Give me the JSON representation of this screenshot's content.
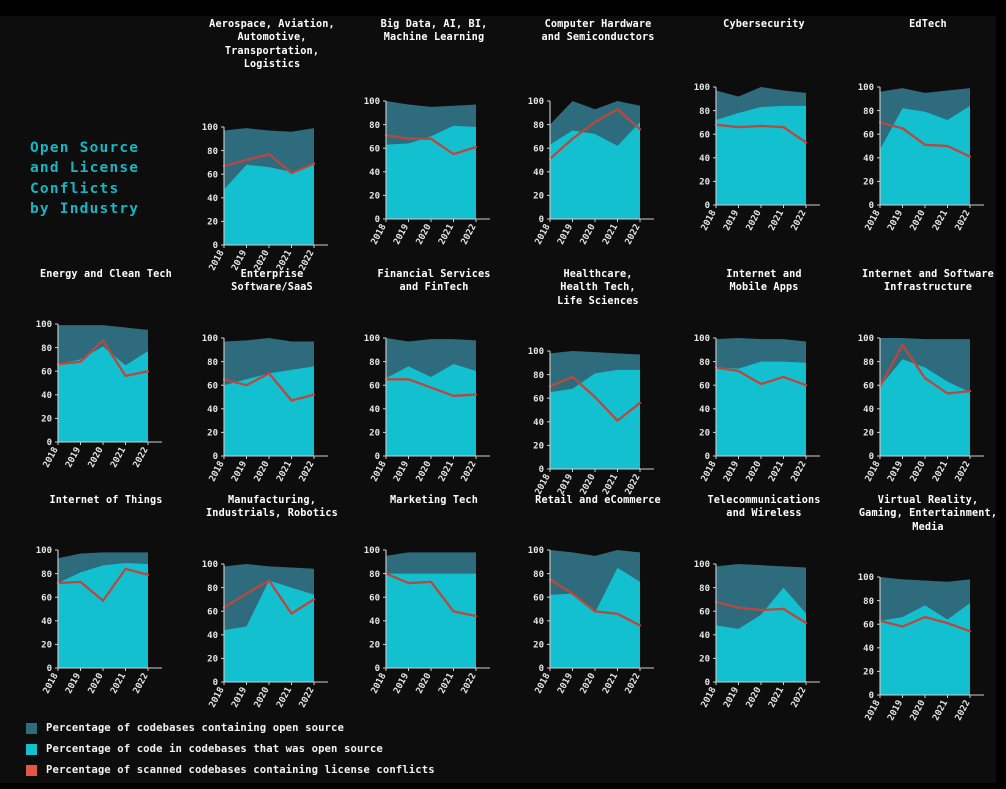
{
  "title": "Open Source\nand License\nConflicts\nby Industry",
  "colors": {
    "background": "#0d0d0d",
    "outer": "#000000",
    "title_text": "#17b6c4",
    "panel_title_text": "#ffffff",
    "codebases_containing_open_source": "#2e6b7d",
    "code_that_was_open_source": "#13c0cf",
    "license_conflicts": "#b9483f",
    "axis": "#cfcfcf",
    "tick_text": "#e6e6e6"
  },
  "legend": {
    "items": [
      {
        "label": "Percentage of codebases containing open source",
        "color": "#2e6b7d",
        "swatch": "square-swatch"
      },
      {
        "label": "Percentage of code in codebases that was open source",
        "color": "#13c0cf",
        "swatch": "square-swatch"
      },
      {
        "label": "Percentage of scanned codebases containing license conflicts",
        "color": "#e0584a",
        "swatch": "square-swatch"
      }
    ]
  },
  "axis": {
    "y_ticks": [
      "0",
      "20",
      "40",
      "60",
      "80",
      "100"
    ],
    "y_values": [
      0,
      20,
      40,
      60,
      80,
      100
    ],
    "x_ticks": [
      "2018",
      "2019",
      "2020",
      "2021",
      "2022"
    ],
    "ylim": [
      0,
      100
    ]
  },
  "chart_data": {
    "type": "area",
    "title": "Open Source and License Conflicts by Industry",
    "xlabel": "",
    "ylabel": "",
    "ylim": [
      0,
      100
    ],
    "grid": false,
    "legend_position": "bottom-left",
    "x": [
      "2018",
      "2019",
      "2020",
      "2021",
      "2022"
    ],
    "series_names": [
      "Percentage of codebases containing open source",
      "Percentage of code in codebases that was open source",
      "Percentage of scanned codebases containing license conflicts"
    ],
    "panels": [
      {
        "title": "Aerospace, Aviation,\nAutomotive,\nTransportation,\nLogistics",
        "codebases_containing_open_source": [
          97,
          99,
          97,
          96,
          99
        ],
        "code_that_was_open_source": [
          47,
          68,
          66,
          62,
          69
        ],
        "license_conflicts": [
          67,
          72,
          77,
          61,
          69
        ]
      },
      {
        "title": "Big Data, AI, BI,\nMachine Learning",
        "codebases_containing_open_source": [
          100,
          97,
          95,
          96,
          97
        ],
        "code_that_was_open_source": [
          63,
          64,
          70,
          79,
          78
        ],
        "license_conflicts": [
          71,
          68,
          68,
          55,
          61
        ]
      },
      {
        "title": "Computer Hardware\nand Semiconductors",
        "codebases_containing_open_source": [
          80,
          100,
          93,
          100,
          96
        ],
        "code_that_was_open_source": [
          63,
          75,
          72,
          62,
          82
        ],
        "license_conflicts": [
          51,
          68,
          82,
          93,
          76
        ]
      },
      {
        "title": "Cybersecurity",
        "codebases_containing_open_source": [
          97,
          92,
          100,
          97,
          95
        ],
        "code_that_was_open_source": [
          72,
          78,
          83,
          84,
          84
        ],
        "license_conflicts": [
          68,
          66,
          67,
          66,
          53
        ]
      },
      {
        "title": "EdTech",
        "codebases_containing_open_source": [
          96,
          99,
          95,
          97,
          99
        ],
        "code_that_was_open_source": [
          47,
          82,
          79,
          72,
          84
        ],
        "license_conflicts": [
          70,
          65,
          51,
          50,
          41
        ]
      },
      {
        "title": "Energy and Clean Tech",
        "codebases_containing_open_source": [
          99,
          99,
          99,
          97,
          95
        ],
        "code_that_was_open_source": [
          66,
          70,
          81,
          65,
          77
        ],
        "license_conflicts": [
          66,
          68,
          86,
          56,
          60
        ]
      },
      {
        "title": "Enterprise\nSoftware/SaaS",
        "codebases_containing_open_source": [
          97,
          98,
          100,
          97,
          97
        ],
        "code_that_was_open_source": [
          60,
          65,
          70,
          73,
          76
        ],
        "license_conflicts": [
          65,
          60,
          70,
          47,
          52
        ]
      },
      {
        "title": "Financial Services\nand FinTech",
        "codebases_containing_open_source": [
          100,
          97,
          99,
          99,
          98
        ],
        "code_that_was_open_source": [
          66,
          76,
          67,
          78,
          72
        ],
        "license_conflicts": [
          65,
          65,
          58,
          51,
          52
        ]
      },
      {
        "title": "Healthcare,\nHealth Tech,\nLife Sciences",
        "codebases_containing_open_source": [
          98,
          100,
          99,
          98,
          97
        ],
        "code_that_was_open_source": [
          65,
          68,
          81,
          84,
          84
        ],
        "license_conflicts": [
          70,
          78,
          61,
          41,
          56
        ]
      },
      {
        "title": "Internet and\nMobile Apps",
        "codebases_containing_open_source": [
          99,
          100,
          99,
          99,
          97
        ],
        "code_that_was_open_source": [
          75,
          74,
          80,
          80,
          79
        ],
        "license_conflicts": [
          75,
          72,
          61,
          67,
          60
        ]
      },
      {
        "title": "Internet and Software\nInfrastructure",
        "codebases_containing_open_source": [
          100,
          100,
          99,
          99,
          99
        ],
        "code_that_was_open_source": [
          59,
          82,
          75,
          63,
          54
        ],
        "license_conflicts": [
          59,
          94,
          66,
          53,
          55
        ]
      },
      {
        "title": "Internet of Things",
        "codebases_containing_open_source": [
          93,
          97,
          98,
          98,
          98
        ],
        "code_that_was_open_source": [
          72,
          81,
          87,
          89,
          88
        ],
        "license_conflicts": [
          72,
          73,
          57,
          84,
          79
        ]
      },
      {
        "title": "Manufacturing,\nIndustrials, Robotics",
        "codebases_containing_open_source": [
          98,
          100,
          98,
          97,
          96
        ],
        "code_that_was_open_source": [
          44,
          47,
          86,
          80,
          74
        ],
        "license_conflicts": [
          63,
          75,
          86,
          58,
          70
        ]
      },
      {
        "title": "Marketing Tech",
        "codebases_containing_open_source": [
          95,
          98,
          98,
          98,
          98
        ],
        "code_that_was_open_source": [
          80,
          80,
          80,
          80,
          80
        ],
        "license_conflicts": [
          80,
          72,
          73,
          48,
          44
        ]
      },
      {
        "title": "Retail and eCommerce",
        "codebases_containing_open_source": [
          100,
          98,
          95,
          100,
          98
        ],
        "code_that_was_open_source": [
          62,
          63,
          47,
          85,
          73
        ],
        "license_conflicts": [
          75,
          63,
          48,
          46,
          36
        ]
      },
      {
        "title": "Telecommunications\nand Wireless",
        "codebases_containing_open_source": [
          98,
          100,
          99,
          98,
          97
        ],
        "code_that_was_open_source": [
          48,
          45,
          57,
          80,
          58
        ],
        "license_conflicts": [
          68,
          63,
          61,
          62,
          50
        ]
      },
      {
        "title": "Virtual Reality,\nGaming, Entertainment,\nMedia",
        "codebases_containing_open_source": [
          100,
          98,
          97,
          96,
          98
        ],
        "code_that_was_open_source": [
          63,
          66,
          76,
          64,
          78
        ],
        "license_conflicts": [
          63,
          58,
          66,
          61,
          54
        ]
      }
    ]
  }
}
